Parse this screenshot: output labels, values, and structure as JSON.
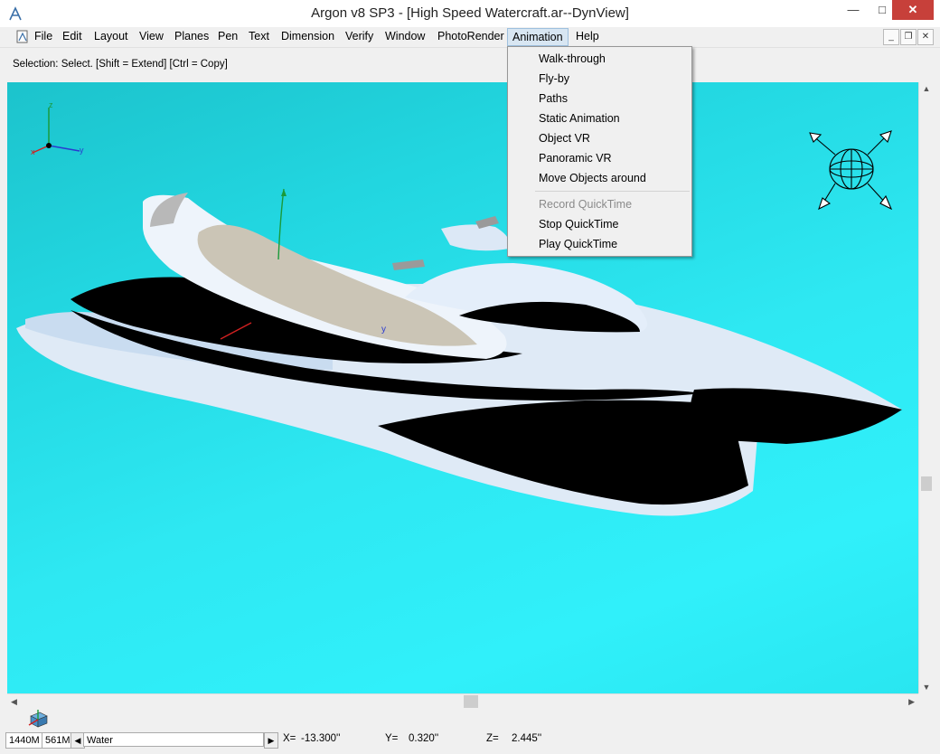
{
  "window": {
    "title": "Argon v8 SP3 - [High Speed Watercraft.ar--DynView]",
    "minimize_label": "—",
    "maximize_label": "□",
    "close_label": "✕"
  },
  "menubar": {
    "items": [
      {
        "label": "File"
      },
      {
        "label": "Edit"
      },
      {
        "label": "Layout"
      },
      {
        "label": "View"
      },
      {
        "label": "Planes"
      },
      {
        "label": "Pen"
      },
      {
        "label": "Text"
      },
      {
        "label": "Dimension"
      },
      {
        "label": "Verify"
      },
      {
        "label": "Window"
      },
      {
        "label": "PhotoRender"
      },
      {
        "label": "Animation"
      },
      {
        "label": "Help"
      }
    ],
    "active_menu": "Animation",
    "mdi_minimize": "_",
    "mdi_restore": "❐",
    "mdi_close": "✕"
  },
  "status": {
    "prompt": "Selection: Select. [Shift = Extend] [Ctrl = Copy]"
  },
  "viewport": {
    "background_color": "#2ee8f2",
    "axis_labels": {
      "z": "z",
      "x": "x",
      "y": "y"
    },
    "model_axis_label": "y"
  },
  "animation_menu": {
    "items": [
      {
        "label": "Walk-through",
        "enabled": true
      },
      {
        "label": "Fly-by",
        "enabled": true
      },
      {
        "label": "Paths",
        "enabled": true
      },
      {
        "label": "Static Animation",
        "enabled": true
      },
      {
        "label": "Object VR",
        "enabled": true
      },
      {
        "label": "Panoramic VR",
        "enabled": true
      },
      {
        "label": "Move Objects around",
        "enabled": true
      },
      {
        "label": "Record QuickTime",
        "enabled": false
      },
      {
        "label": "Stop QuickTime",
        "enabled": true
      },
      {
        "label": "Play QuickTime",
        "enabled": true
      }
    ]
  },
  "statusbar": {
    "memory_total": "1440M",
    "memory_free": "561M",
    "layer": "Water",
    "x_label": "X=",
    "x_value": "-13.300''",
    "y_label": "Y=",
    "y_value": "0.320''",
    "z_label": "Z=",
    "z_value": "2.445''"
  }
}
